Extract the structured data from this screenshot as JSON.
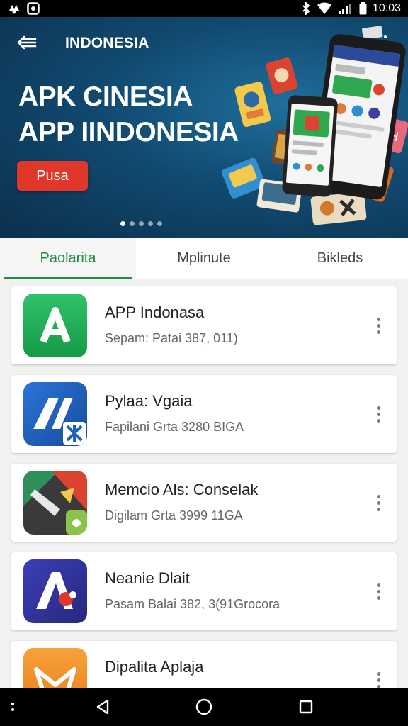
{
  "status_bar": {
    "time": "10:03",
    "icons": [
      "notification-icon",
      "image-icon",
      "bluetooth-icon",
      "wifi-icon",
      "signal-icon",
      "battery-icon"
    ]
  },
  "header": {
    "title": "INDONESIA",
    "headline_line1": "APK CINESIA",
    "headline_line2": "APP IINDONESIA",
    "cta_label": "Pusa",
    "carousel_pages": 5,
    "carousel_active": 0
  },
  "tabs": [
    {
      "label": "Paolarita",
      "active": true
    },
    {
      "label": "Mplinute",
      "active": false
    },
    {
      "label": "Bikleds",
      "active": false
    }
  ],
  "apps": [
    {
      "name": "APP Indonasa",
      "subtitle": "Sepam: Patai 387, 011)",
      "icon": "green-a-icon"
    },
    {
      "name": "Pylaa: Vgaia",
      "subtitle": "Fapilani Grta 3280 BIGA",
      "icon": "blue-a-icon"
    },
    {
      "name": "Memcio Als: Conselak",
      "subtitle": "Digilam Grta 3999 11GA",
      "icon": "tools-icon"
    },
    {
      "name": "Neanie Dlait",
      "subtitle": "Pasam Balai 382, 3(91Grocora",
      "icon": "purple-a-icon"
    },
    {
      "name": "Dipalita Aplaja",
      "subtitle": "",
      "icon": "orange-mail-icon"
    }
  ],
  "colors": {
    "accent_green": "#1e8e3e",
    "cta_red": "#e0372b",
    "hero_blue": "#114a70"
  }
}
